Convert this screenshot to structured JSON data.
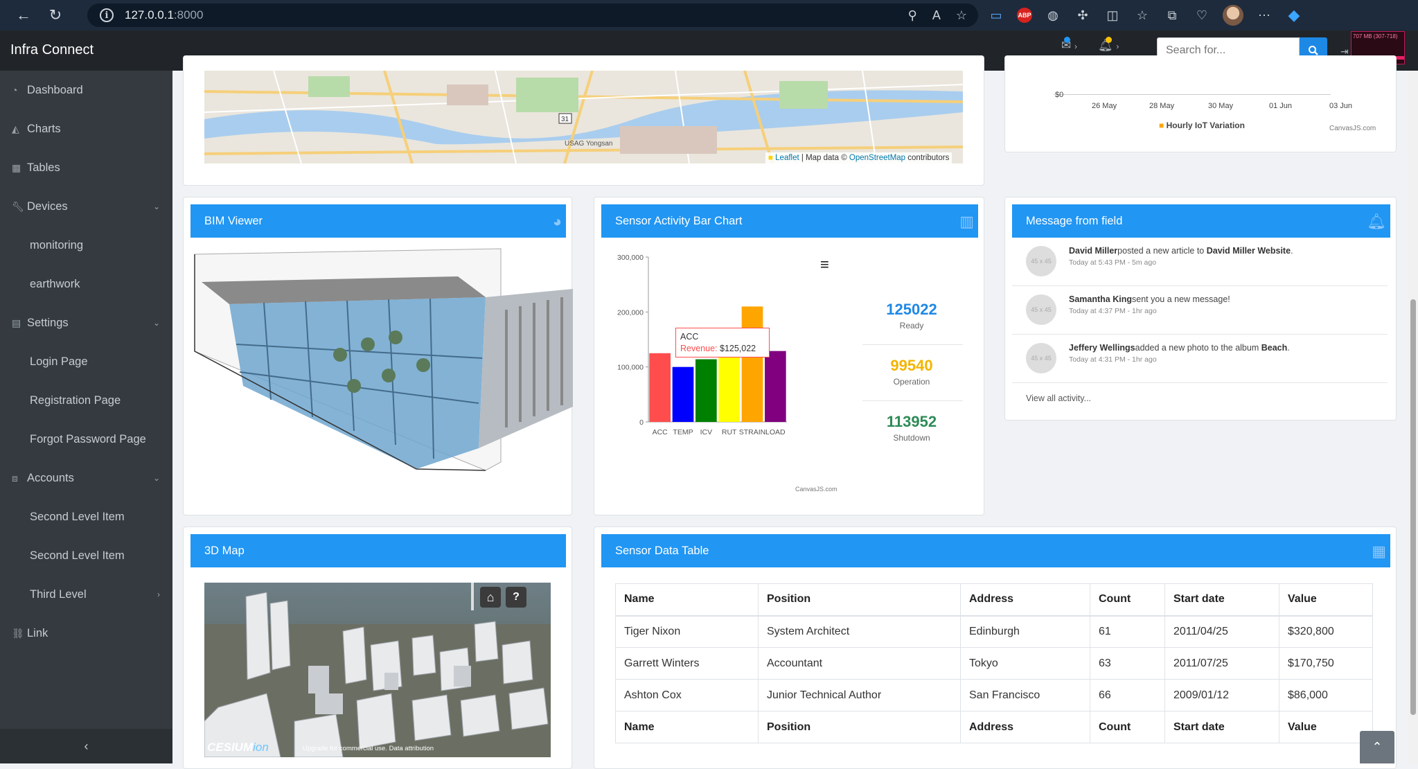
{
  "browser": {
    "url_host": "127.0.0.1",
    "url_port": ":8000"
  },
  "header": {
    "brand": "Infra Connect",
    "search_placeholder": "Search for...",
    "mem_widget": "707 MB (307-718)",
    "colors": {
      "accent": "#2196f3",
      "sidebar": "#343a40",
      "topbar": "#212529"
    }
  },
  "sidebar": {
    "items": [
      {
        "label": "Dashboard",
        "icon": "dashboard-icon"
      },
      {
        "label": "Charts",
        "icon": "chart-area-icon"
      },
      {
        "label": "Tables",
        "icon": "table-icon"
      },
      {
        "label": "Devices",
        "icon": "wrench-icon"
      },
      {
        "label": "monitoring"
      },
      {
        "label": "earthwork"
      },
      {
        "label": "Settings",
        "icon": "file-icon"
      },
      {
        "label": "Login Page"
      },
      {
        "label": "Registration Page"
      },
      {
        "label": "Forgot Password Page"
      },
      {
        "label": "Accounts",
        "icon": "sitemap-icon"
      },
      {
        "label": "Second Level Item"
      },
      {
        "label": "Second Level Item"
      },
      {
        "label": "Third Level"
      },
      {
        "label": "Link",
        "icon": "link-icon"
      }
    ],
    "collapse_glyph": "‹"
  },
  "map2d": {
    "attribution_leaflet": "Leaflet",
    "attribution_mid": " | Map data © ",
    "attribution_osm": "OpenStreetMap",
    "attribution_end": " contributors",
    "labels": [
      "USAG Yongsan",
      "31"
    ]
  },
  "iot_chart": {
    "ytick": "$0",
    "xticks": [
      "26 May",
      "28 May",
      "30 May",
      "01 Jun",
      "03 Jun"
    ],
    "legend": "Hourly IoT Variation",
    "credit": "CanvasJS.com"
  },
  "bim": {
    "title": "BIM Viewer"
  },
  "bar_card": {
    "title": "Sensor Activity Bar Chart",
    "tooltip": {
      "category": "ACC",
      "label": "Revenue:",
      "value": "$125,022"
    },
    "credit": "CanvasJS.com",
    "menu_glyph": "≡"
  },
  "chart_data": {
    "type": "bar",
    "categories": [
      "ACC",
      "TEMP",
      "ICV",
      "RUT",
      "STRAIN",
      "LOAD"
    ],
    "values": [
      125022,
      100000,
      114000,
      158000,
      210000,
      129000
    ],
    "colors": [
      "#ff4d4d",
      "#0000ff",
      "#008000",
      "#ffff00",
      "#ffa500",
      "#800080"
    ],
    "ylim": [
      0,
      300000
    ],
    "yticks": [
      0,
      100000,
      200000,
      300000
    ],
    "ytick_labels": [
      "0",
      "100,000",
      "200,000",
      "300,000"
    ],
    "grid": false
  },
  "stats": [
    {
      "value": "125022",
      "label": "Ready",
      "color": "#1e88e5"
    },
    {
      "value": "99540",
      "label": "Operation",
      "color": "#f4b400"
    },
    {
      "value": "113952",
      "label": "Shutdown",
      "color": "#2e8b57"
    }
  ],
  "messages_card": {
    "title": "Message from field",
    "items": [
      {
        "name": "David Miller",
        "text": "posted a new article to ",
        "target": "David Miller Website",
        "end": ".",
        "time": "Today at 5:43 PM - 5m ago"
      },
      {
        "name": "Samantha King",
        "text": "sent you a new message!",
        "target": "",
        "end": "",
        "time": "Today at 4:37 PM - 1hr ago"
      },
      {
        "name": "Jeffery Wellings",
        "text": "added a new photo to the album ",
        "target": "Beach",
        "end": ".",
        "time": "Today at 4:31 PM - 1hr ago"
      }
    ],
    "avatar_text": "45 x 45",
    "view_all": "View all activity..."
  },
  "map3d": {
    "title": "3D Map",
    "cesium": "CESIUM",
    "ion": "ion",
    "upgrade": "Upgrade for commercial use. Data attribution"
  },
  "table_card": {
    "title": "Sensor Data Table",
    "columns": [
      "Name",
      "Position",
      "Address",
      "Count",
      "Start date",
      "Value"
    ],
    "rows": [
      [
        "Tiger Nixon",
        "System Architect",
        "Edinburgh",
        "61",
        "2011/04/25",
        "$320,800"
      ],
      [
        "Garrett Winters",
        "Accountant",
        "Tokyo",
        "63",
        "2011/07/25",
        "$170,750"
      ],
      [
        "Ashton Cox",
        "Junior Technical Author",
        "San Francisco",
        "66",
        "2009/01/12",
        "$86,000"
      ]
    ]
  }
}
